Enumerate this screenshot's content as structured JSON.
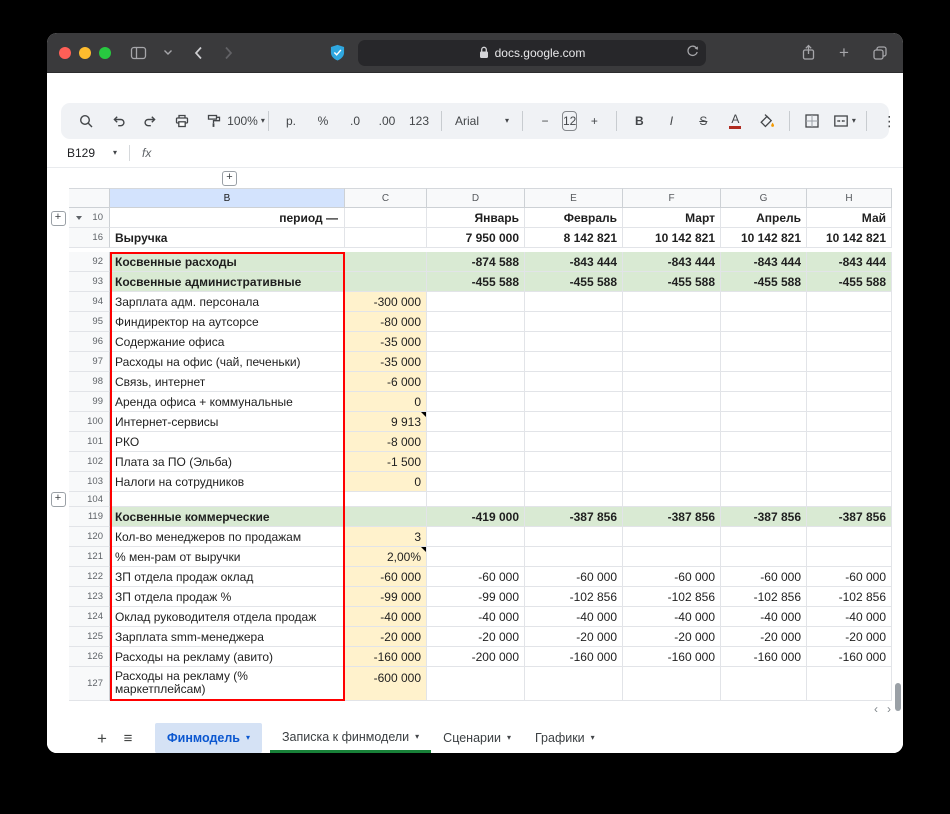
{
  "browser": {
    "url": "docs.google.com"
  },
  "sheets_toolbar": {
    "zoom": "100%",
    "currency_format": "р.",
    "percent_format": "%",
    "decrease_decimal": ".0",
    "increase_decimal": ".00",
    "more_formats": "123",
    "font_name": "Arial",
    "decrease_font_size": "−",
    "font_size": "12",
    "increase_font_size": "+",
    "bold": "B",
    "italic": "I",
    "strikethrough": "S",
    "text_color": "A",
    "more_options": "⋮"
  },
  "formula_bar": {
    "cell_ref": "B129",
    "fx_label": "fx"
  },
  "icons": {
    "caret_down": "▾",
    "plus_box": "+",
    "add_sheet": "+",
    "all_sheets_menu": "≡",
    "scroll_left": "‹",
    "scroll_right": "›"
  },
  "colors": {
    "section_row_bg": "#d9ead3",
    "input_cell_bg": "#fff2cc",
    "highlight_border": "#ff0000",
    "active_header_bg": "#d3e3fd",
    "active_tab_bg": "#d5e2f5",
    "active_tab_text": "#0b57d0",
    "green_tab_underline": "#188038"
  },
  "grid": {
    "columns": [
      "B",
      "C",
      "D",
      "E",
      "F",
      "G",
      "H"
    ],
    "active_column": "B",
    "rows": [
      {
        "num": "10",
        "tri": true,
        "plus": true,
        "b": "период —",
        "b_align": "right",
        "d": "Январь",
        "e": "Февраль",
        "f": "Март",
        "g": "Апрель",
        "h": "Май",
        "bold": true
      },
      {
        "num": "16",
        "b": "Выручка",
        "d": "7 950 000",
        "e": "8 142 821",
        "f": "10 142 821",
        "g": "10 142 821",
        "h": "10 142 821",
        "bold": true
      },
      {
        "gap": true
      },
      {
        "num": "92",
        "b": "Косвенные расходы",
        "d": "-874 588",
        "e": "-843 444",
        "f": "-843 444",
        "g": "-843 444",
        "h": "-843 444",
        "bold": true,
        "green": true
      },
      {
        "num": "93",
        "b": "Косвенные административные",
        "d": "-455 588",
        "e": "-455 588",
        "f": "-455 588",
        "g": "-455 588",
        "h": "-455 588",
        "bold": true,
        "green": true
      },
      {
        "num": "94",
        "b": "Зарплата адм. персонала",
        "c": "-300 000",
        "cy": true
      },
      {
        "num": "95",
        "b": "Финдиректор на аутсорсе",
        "c": "-80 000",
        "cy": true
      },
      {
        "num": "96",
        "b": "Содержание офиса",
        "c": "-35 000",
        "cy": true
      },
      {
        "num": "97",
        "b": "Расходы на офис (чай, печеньки)",
        "c": "-35 000",
        "cy": true
      },
      {
        "num": "98",
        "b": "Связь, интернет",
        "c": "-6 000",
        "cy": true
      },
      {
        "num": "99",
        "b": "Аренда офиса + коммунальные",
        "c": "0",
        "cy": true
      },
      {
        "num": "100",
        "b": "Интернет-сервисы",
        "c": "9 913",
        "cy": true,
        "note": true
      },
      {
        "num": "101",
        "b": "РКО",
        "c": "-8 000",
        "cy": true
      },
      {
        "num": "102",
        "b": "Плата за ПО (Эльба)",
        "c": "-1 500",
        "cy": true
      },
      {
        "num": "103",
        "b": "Налоги на сотрудников",
        "c": "0",
        "cy": true
      },
      {
        "num": "104",
        "plus": true,
        "short": true
      },
      {
        "num": "119",
        "b": "Косвенные коммерческие",
        "d": "-419 000",
        "e": "-387 856",
        "f": "-387 856",
        "g": "-387 856",
        "h": "-387 856",
        "bold": true,
        "green": true
      },
      {
        "num": "120",
        "b": "Кол-во менеджеров по продажам",
        "c": "3",
        "cy": true
      },
      {
        "num": "121",
        "b": "% мен-рам от выручки",
        "c": "2,00%",
        "cy": true,
        "note": true
      },
      {
        "num": "122",
        "b": "ЗП отдела продаж оклад",
        "c": "-60 000",
        "cy": true,
        "d": "-60 000",
        "e": "-60 000",
        "f": "-60 000",
        "g": "-60 000",
        "h": "-60 000"
      },
      {
        "num": "123",
        "b": "ЗП отдела продаж %",
        "c": "-99 000",
        "cy": true,
        "d": "-99 000",
        "e": "-102 856",
        "f": "-102 856",
        "g": "-102 856",
        "h": "-102 856"
      },
      {
        "num": "124",
        "b": "Оклад руководителя отдела продаж",
        "c": "-40 000",
        "cy": true,
        "d": "-40 000",
        "e": "-40 000",
        "f": "-40 000",
        "g": "-40 000",
        "h": "-40 000"
      },
      {
        "num": "125",
        "b": "Зарплата smm-менеджера",
        "c": "-20 000",
        "cy": true,
        "d": "-20 000",
        "e": "-20 000",
        "f": "-20 000",
        "g": "-20 000",
        "h": "-20 000"
      },
      {
        "num": "126",
        "b": "Расходы на рекламу (авито)",
        "c": "-160 000",
        "cy": true,
        "d": "-200 000",
        "e": "-160 000",
        "f": "-160 000",
        "g": "-160 000",
        "h": "-160 000"
      },
      {
        "num": "127",
        "b": "Расходы на рекламу (% маркетплейсам)",
        "c": "-600 000",
        "cy": true,
        "tall": true
      }
    ]
  },
  "sheet_tabs": {
    "items": [
      {
        "label": "Финмодель",
        "active": true
      },
      {
        "label": "Записка к финмодели",
        "underline": "green"
      },
      {
        "label": "Сценарии"
      },
      {
        "label": "Графики"
      }
    ]
  }
}
